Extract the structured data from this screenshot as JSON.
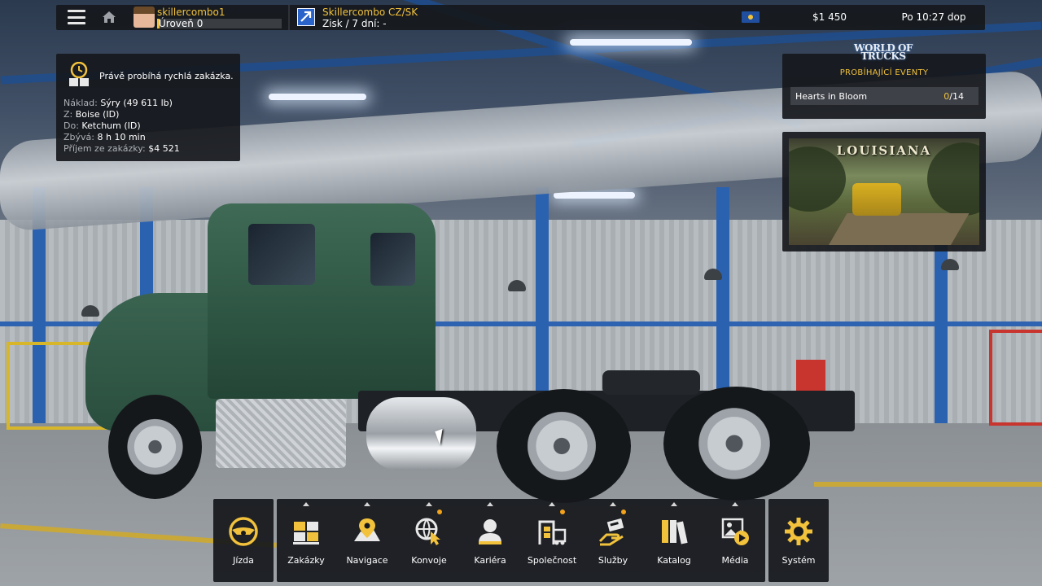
{
  "topbar": {
    "profile_name": "skillercombo1",
    "level": "Úroveň 0",
    "company_name": "Skillercombo CZ/SK",
    "company_profit": "Zisk / 7 dní: -",
    "money": "$1 450",
    "clock": "Po 10:27 dop"
  },
  "job": {
    "title": "Právě probíhá rychlá zakázka.",
    "rows": [
      {
        "label": "Náklad:",
        "value": "Sýry (49 611 lb)"
      },
      {
        "label": "Z:",
        "value": "Boise (ID)"
      },
      {
        "label": "Do:",
        "value": "Ketchum (ID)"
      },
      {
        "label": "Zbývá:",
        "value": "8 h 10 min"
      },
      {
        "label": "Příjem ze zakázky:",
        "value": "$4 521"
      }
    ]
  },
  "events": {
    "logo_line1": "WORLD OF",
    "logo_line2": "TRUCKS",
    "title": "PROBÍHAJÍCÍ EVENTY",
    "items": [
      {
        "name": "Hearts in Bloom",
        "done": "0",
        "total": "/14"
      }
    ]
  },
  "ad": {
    "title": "LOUISIANA"
  },
  "dock": {
    "drive": {
      "label": "Jízda",
      "icon": "steering-wheel-icon"
    },
    "items": [
      {
        "label": "Zakázky",
        "icon": "cargo-crates-icon",
        "dot": false
      },
      {
        "label": "Navigace",
        "icon": "map-pin-icon",
        "dot": false
      },
      {
        "label": "Konvoje",
        "icon": "globe-cursor-icon",
        "dot": true
      },
      {
        "label": "Kariéra",
        "icon": "person-icon",
        "dot": false
      },
      {
        "label": "Společnost",
        "icon": "garage-truck-icon",
        "dot": true
      },
      {
        "label": "Služby",
        "icon": "service-hand-icon",
        "dot": true
      },
      {
        "label": "Katalog",
        "icon": "books-icon",
        "dot": false
      },
      {
        "label": "Média",
        "icon": "media-play-icon",
        "dot": false
      }
    ],
    "system": {
      "label": "Systém",
      "icon": "gear-icon"
    }
  },
  "colors": {
    "accent": "#f2c23c",
    "panel_bg": "#16181c",
    "notification_dot": "#f2a31b"
  }
}
